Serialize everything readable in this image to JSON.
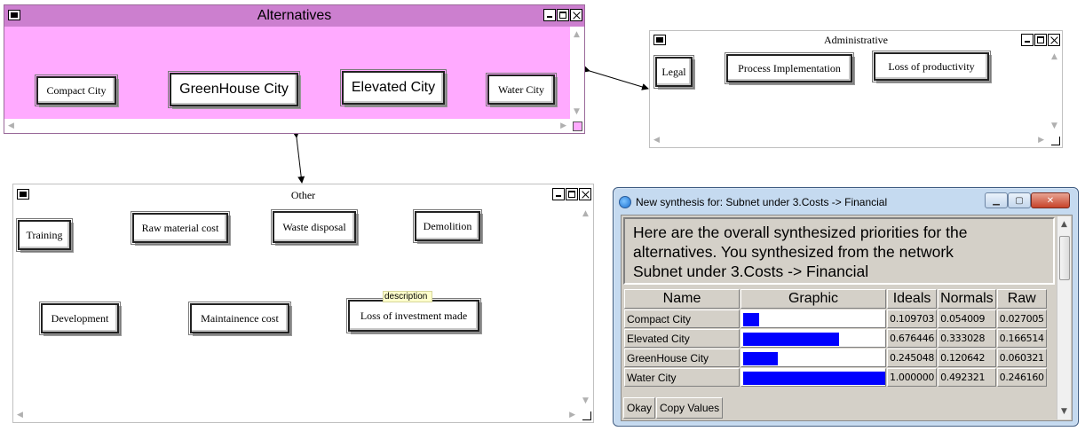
{
  "colors": {
    "alt_title_bg": "#cc7fcf",
    "alt_canvas_bg": "#ffaaff",
    "graphic_bar": "#0000ff"
  },
  "alternatives_window": {
    "title": "Alternatives",
    "nodes": [
      "Compact City",
      "GreenHouse City",
      "Elevated City",
      "Water City"
    ]
  },
  "administrative_window": {
    "title": "Administrative",
    "nodes": [
      "Legal",
      "Process Implementation",
      "Loss of productivity"
    ]
  },
  "other_window": {
    "title": "Other",
    "nodes": [
      "Training",
      "Raw material cost",
      "Waste disposal",
      "Demolition",
      "Development",
      "Maintainence cost",
      "Loss of investment made"
    ],
    "tooltip": "description"
  },
  "synthesis_dialog": {
    "title": "New synthesis for: Subnet under 3.Costs -> Financial",
    "message_lines": [
      "Here are the overall synthesized priorities for the",
      "alternatives.  You synthesized from the network",
      "Subnet under 3.Costs -> Financial"
    ],
    "columns": [
      "Name",
      "Graphic",
      "Ideals",
      "Normals",
      "Raw"
    ],
    "rows": [
      {
        "name": "Compact City",
        "ideal": 0.109703,
        "ideals": "0.109703",
        "normals": "0.054009",
        "raw": "0.027005"
      },
      {
        "name": "Elevated City",
        "ideal": 0.676446,
        "ideals": "0.676446",
        "normals": "0.333028",
        "raw": "0.166514"
      },
      {
        "name": "GreenHouse City",
        "ideal": 0.245048,
        "ideals": "0.245048",
        "normals": "0.120642",
        "raw": "0.060321"
      },
      {
        "name": "Water City",
        "ideal": 1.0,
        "ideals": "1.000000",
        "normals": "0.492321",
        "raw": "0.246160"
      }
    ],
    "buttons": {
      "okay": "Okay",
      "copy": "Copy Values"
    }
  }
}
